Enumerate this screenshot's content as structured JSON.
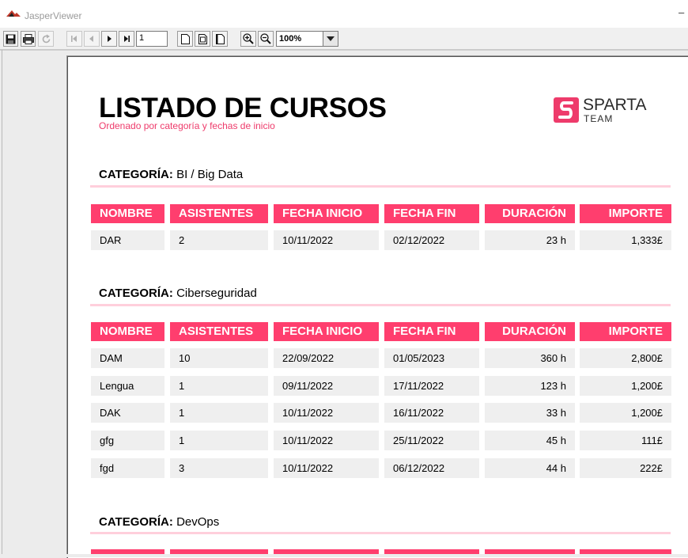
{
  "window": {
    "title": "JasperViewer",
    "minimize_label": "–"
  },
  "toolbar": {
    "page_number": "1",
    "zoom_value": "100%",
    "buttons": [
      "save",
      "print",
      "reload",
      "first-page",
      "previous-page",
      "next-page",
      "last-page",
      "actual-size",
      "fit-page",
      "fit-width",
      "zoom-in",
      "zoom-out"
    ]
  },
  "report": {
    "title": "LISTADO DE CURSOS",
    "subtitle": "Ordenado por categoría y fechas de inicio",
    "logo": {
      "top": "SPARTA",
      "bottom": "TEAM",
      "color": "#ee3b6b"
    },
    "headers": [
      "NOMBRE",
      "ASISTENTES",
      "FECHA INICIO",
      "FECHA FIN",
      "DURACIÓN",
      "IMPORTE"
    ],
    "categories": [
      {
        "label": "CATEGORÍA:",
        "name": "BI / Big Data",
        "rows": [
          [
            "DAR",
            "2",
            "10/11/2022",
            "02/12/2022",
            "23 h",
            "1,333£"
          ]
        ]
      },
      {
        "label": "CATEGORÍA:",
        "name": "Ciberseguridad",
        "rows": [
          [
            "DAM",
            "10",
            "22/09/2022",
            "01/05/2023",
            "360 h",
            "2,800£"
          ],
          [
            "Lengua",
            "1",
            "09/11/2022",
            "17/11/2022",
            "123 h",
            "1,200£"
          ],
          [
            "DAK",
            "1",
            "10/11/2022",
            "16/11/2022",
            "33 h",
            "1,200£"
          ],
          [
            "gfg",
            "1",
            "10/11/2022",
            "25/11/2022",
            "45 h",
            "111£"
          ],
          [
            "fgd",
            "3",
            "10/11/2022",
            "06/12/2022",
            "44 h",
            "222£"
          ]
        ]
      },
      {
        "label": "CATEGORÍA:",
        "name": "DevOps",
        "rows": []
      }
    ]
  },
  "colors": {
    "accent": "#ff3e6e",
    "rule": "#ffcfdc",
    "cell": "#efefef"
  }
}
